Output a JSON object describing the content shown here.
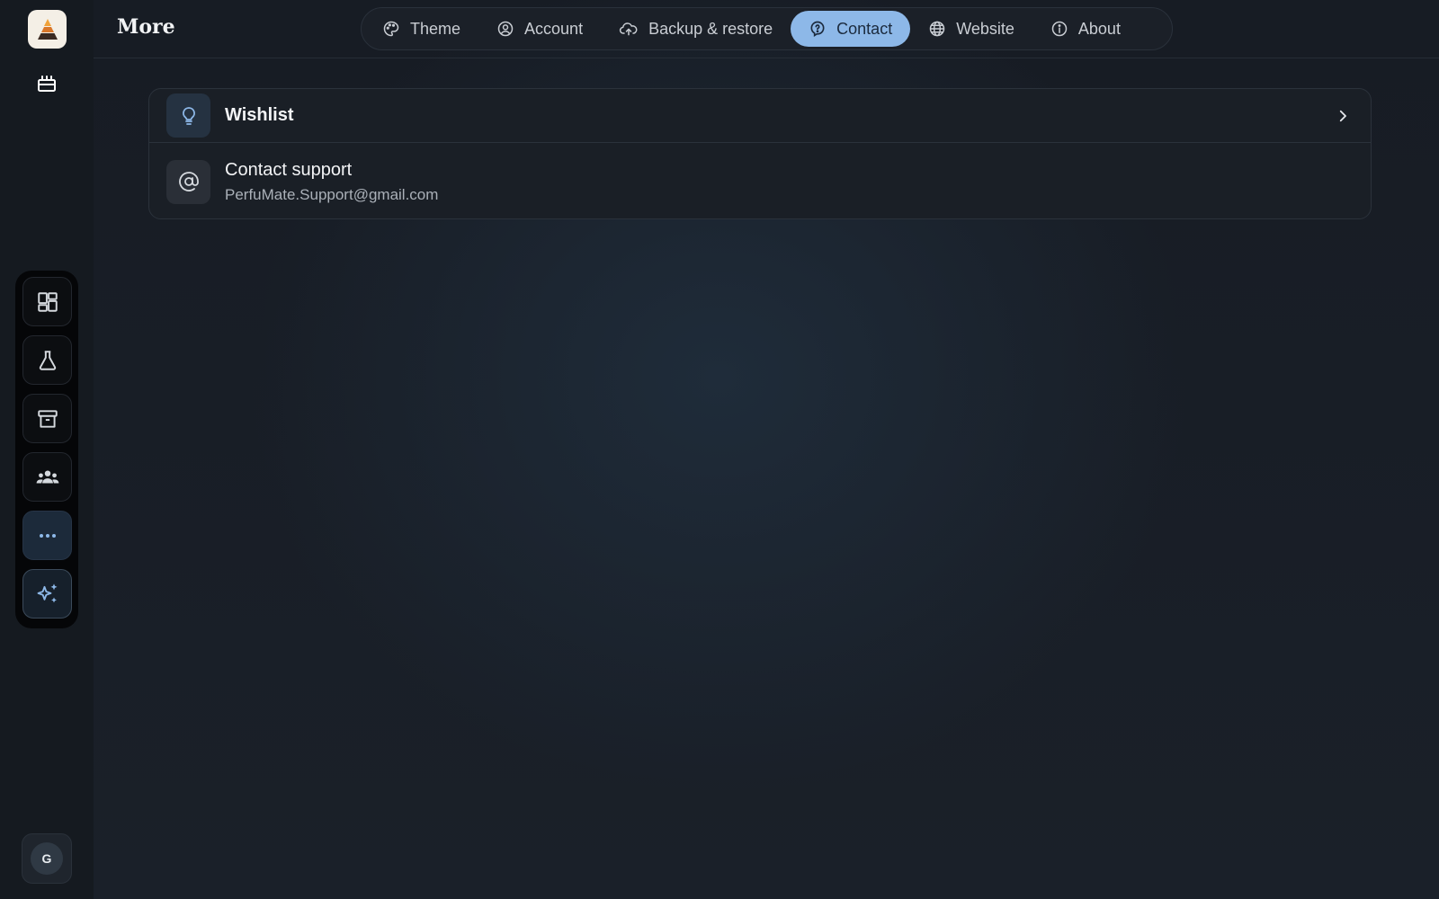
{
  "header": {
    "title": "More"
  },
  "tabs": [
    {
      "label": "Theme",
      "icon": "palette-icon",
      "active": false
    },
    {
      "label": "Account",
      "icon": "user-circle-icon",
      "active": false
    },
    {
      "label": "Backup & restore",
      "icon": "cloud-upload-icon",
      "active": false
    },
    {
      "label": "Contact",
      "icon": "help-circle-icon",
      "active": true
    },
    {
      "label": "Website",
      "icon": "globe-icon",
      "active": false
    },
    {
      "label": "About",
      "icon": "info-icon",
      "active": false
    }
  ],
  "contact": {
    "wishlist": {
      "title": "Wishlist",
      "icon": "lightbulb-icon"
    },
    "support": {
      "title": "Contact support",
      "email": "PerfuMate.Support@gmail.com",
      "icon": "at-sign-icon"
    }
  },
  "sidebar": {
    "top_icons": [
      "app-logo",
      "gift-icon"
    ],
    "nav": [
      {
        "name": "dashboard",
        "icon": "dashboard-icon",
        "active": false
      },
      {
        "name": "lab",
        "icon": "flask-icon",
        "active": false
      },
      {
        "name": "archive",
        "icon": "archive-icon",
        "active": false
      },
      {
        "name": "community",
        "icon": "people-icon",
        "active": false
      },
      {
        "name": "more",
        "icon": "more-dots-icon",
        "active": true
      },
      {
        "name": "ai",
        "icon": "sparkles-icon",
        "active": false
      }
    ],
    "avatar_initial": "G"
  },
  "colors": {
    "accent": "#8db8e8",
    "background": "#171c24",
    "card": "#1a1f26"
  }
}
